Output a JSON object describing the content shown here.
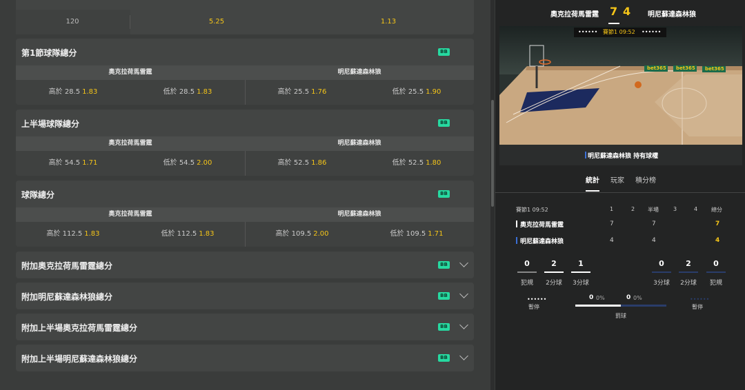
{
  "top_row": {
    "value": "120",
    "odd1": "5.25",
    "odd2": "1.13"
  },
  "cards": [
    {
      "title": "第1節球隊總分",
      "badge": "BB",
      "home": "奧克拉荷馬雷霆",
      "away": "明尼蘇達森林狼",
      "odds": [
        {
          "label": "高於 28.5",
          "price": "1.83"
        },
        {
          "label": "低於 28.5",
          "price": "1.83"
        },
        {
          "label": "高於 25.5",
          "price": "1.76"
        },
        {
          "label": "低於 25.5",
          "price": "1.90"
        }
      ]
    },
    {
      "title": "上半場球隊總分",
      "badge": "BB",
      "home": "奧克拉荷馬雷霆",
      "away": "明尼蘇達森林狼",
      "odds": [
        {
          "label": "高於 54.5",
          "price": "1.71"
        },
        {
          "label": "低於 54.5",
          "price": "2.00"
        },
        {
          "label": "高於 52.5",
          "price": "1.86"
        },
        {
          "label": "低於 52.5",
          "price": "1.80"
        }
      ]
    },
    {
      "title": "球隊總分",
      "badge": "BB",
      "home": "奧克拉荷馬雷霆",
      "away": "明尼蘇達森林狼",
      "odds": [
        {
          "label": "高於 112.5",
          "price": "1.83"
        },
        {
          "label": "低於 112.5",
          "price": "1.83"
        },
        {
          "label": "高於 109.5",
          "price": "2.00"
        },
        {
          "label": "低於 109.5",
          "price": "1.71"
        }
      ]
    }
  ],
  "collapsed": [
    {
      "title": "附加奧克拉荷馬雷霆總分",
      "badge": "BB"
    },
    {
      "title": "附加明尼蘇達森林狼總分",
      "badge": "BB"
    },
    {
      "title": "附加上半場奧克拉荷馬雷霆總分",
      "badge": "BB"
    },
    {
      "title": "附加上半場明尼蘇達森林狼總分",
      "badge": "BB"
    }
  ],
  "scoreboard": {
    "home": "奧克拉荷馬雷霆",
    "away": "明尼蘇達森林狼",
    "home_score": "7",
    "away_score": "4",
    "period_clock": "賽節1 09:52",
    "dots_left": "••••••",
    "dots_right": "••••••",
    "possession": "明尼蘇達森林狼 持有球權",
    "ads": [
      "bet365",
      "bet365",
      "bet365"
    ]
  },
  "tabs": [
    "統計",
    "玩家",
    "積分榜"
  ],
  "stats_table": {
    "period": "賽節1 09:52",
    "headers": [
      "1",
      "2",
      "半場",
      "3",
      "4",
      "總分"
    ],
    "rows": [
      {
        "team": "奧克拉荷馬雷霆",
        "q1": "7",
        "half": "7",
        "total": "7"
      },
      {
        "team": "明尼蘇達森林狼",
        "q1": "4",
        "half": "4",
        "total": "4"
      }
    ]
  },
  "team_stats": {
    "home": [
      {
        "value": "0",
        "label": "犯規"
      },
      {
        "value": "2",
        "label": "2分球"
      },
      {
        "value": "1",
        "label": "3分球"
      }
    ],
    "away": [
      {
        "value": "0",
        "label": "3分球"
      },
      {
        "value": "2",
        "label": "2分球"
      },
      {
        "value": "0",
        "label": "犯規"
      }
    ],
    "timeout_label": "暫停",
    "timeout_dots": "••••••",
    "ft_home": "0",
    "ft_home_pct": "0%",
    "ft_away": "0",
    "ft_away_pct": "0%",
    "ft_label": "罰球"
  },
  "colors": {
    "accent": "#f5c518",
    "badge": "#26d9a0",
    "home": "#ffffff",
    "away": "#3b6fd6"
  }
}
